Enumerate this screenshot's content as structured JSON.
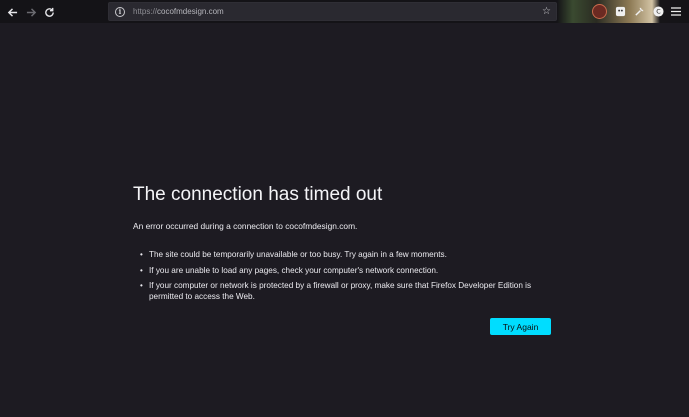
{
  "toolbar": {
    "url_scheme": "https://",
    "url_host": "cocofmdesign.com",
    "icons": {
      "back": "back-arrow-icon",
      "forward": "forward-arrow-icon",
      "reload": "reload-icon",
      "site_info": "info-icon",
      "bookmark": "star-icon",
      "extensions": [
        "extension-icon",
        "tools-icon",
        "account-icon"
      ],
      "menu": "hamburger-menu-icon"
    }
  },
  "error": {
    "title": "The connection has timed out",
    "intro": "An error occurred during a connection to cocofmdesign.com.",
    "items": [
      "The site could be temporarily unavailable or too busy. Try again in a few moments.",
      "If you are unable to load any pages, check your computer's network connection.",
      "If your computer or network is protected by a firewall or proxy, make sure that Firefox Developer Edition is permitted to access the Web."
    ],
    "button_label": "Try Again"
  },
  "colors": {
    "page_background": "#1d1b22",
    "toolbar_background": "#141317",
    "button_accent": "#00ddff"
  }
}
